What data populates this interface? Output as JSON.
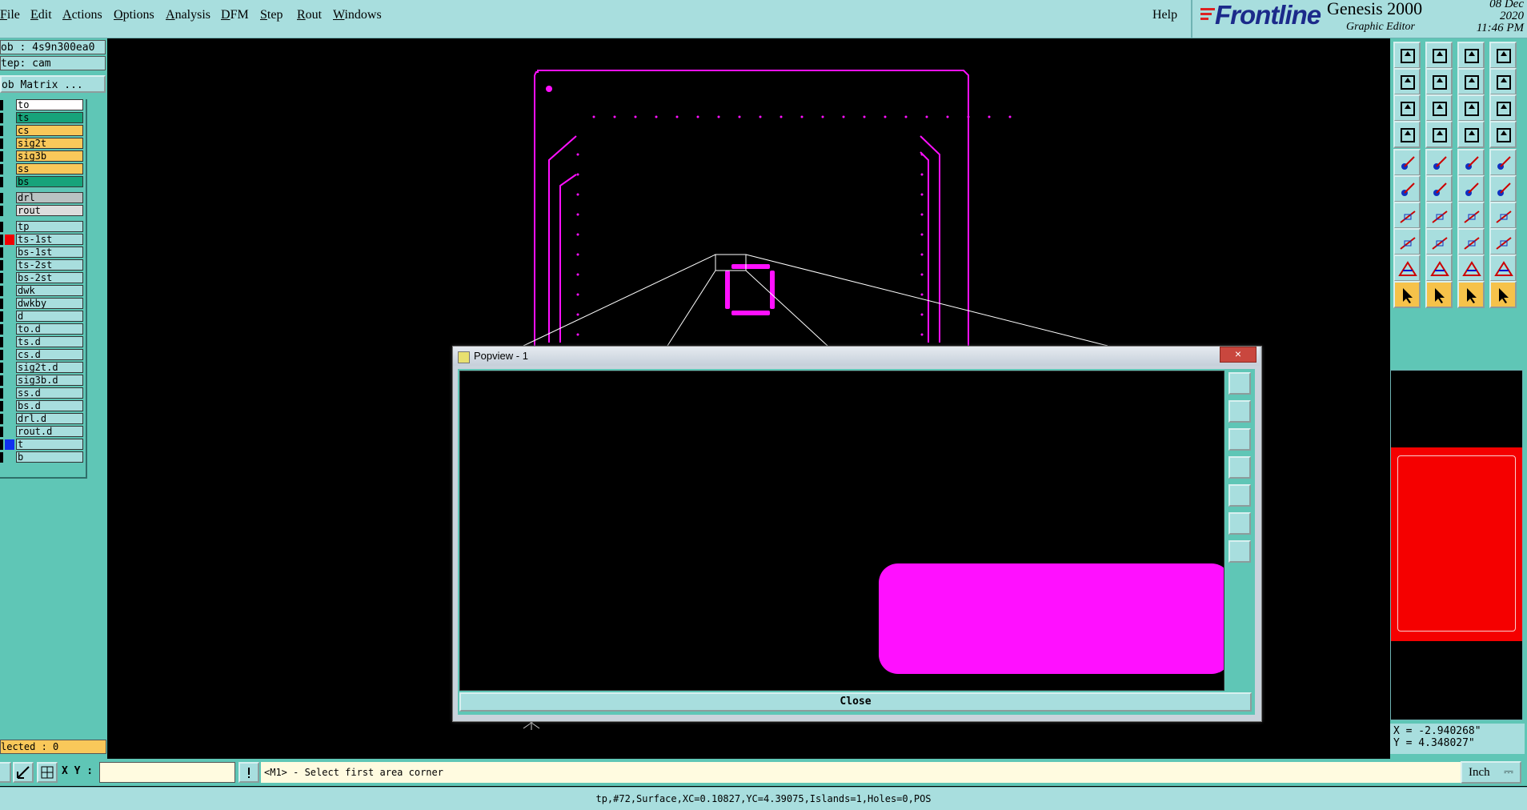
{
  "menubar": {
    "items": [
      "File",
      "Edit",
      "Actions",
      "Options",
      "Analysis",
      "DFM",
      "Step",
      "Rout",
      "Windows"
    ],
    "help": "Help"
  },
  "brand": {
    "logo": "Frontline",
    "product": "Genesis 2000",
    "subtitle": "Graphic Editor",
    "date": "08 Dec 2020",
    "time": "11:46 PM"
  },
  "left_panel": {
    "job": "ob : 4s9n300ea0",
    "step": "tep: cam",
    "matrix_button": "ob Matrix ...",
    "layers": [
      {
        "name": "to",
        "bg": "#ffffff",
        "flag": ""
      },
      {
        "name": "ts",
        "bg": "#17a37a",
        "flag": ""
      },
      {
        "name": "cs",
        "bg": "#f9c85a",
        "flag": ""
      },
      {
        "name": "sig2t",
        "bg": "#f9c85a",
        "flag": ""
      },
      {
        "name": "sig3b",
        "bg": "#f9c85a",
        "flag": ""
      },
      {
        "name": "ss",
        "bg": "#f9c85a",
        "flag": ""
      },
      {
        "name": "bs",
        "bg": "#17a37a",
        "flag": ""
      },
      {
        "name": "drl",
        "bg": "#b9c2c2",
        "flag": ""
      },
      {
        "name": "rout",
        "bg": "#dddddd",
        "flag": ""
      },
      {
        "name": "tp",
        "bg": "#a8dede",
        "flag": ""
      },
      {
        "name": "ts-1st",
        "bg": "#a8dede",
        "flag": "#f00000"
      },
      {
        "name": "bs-1st",
        "bg": "#a8dede",
        "flag": ""
      },
      {
        "name": "ts-2st",
        "bg": "#a8dede",
        "flag": ""
      },
      {
        "name": "bs-2st",
        "bg": "#a8dede",
        "flag": ""
      },
      {
        "name": "dwk",
        "bg": "#a8dede",
        "flag": ""
      },
      {
        "name": "dwkby",
        "bg": "#a8dede",
        "flag": ""
      },
      {
        "name": "d",
        "bg": "#a8dede",
        "flag": ""
      },
      {
        "name": "to.d",
        "bg": "#a8dede",
        "flag": ""
      },
      {
        "name": "ts.d",
        "bg": "#a8dede",
        "flag": ""
      },
      {
        "name": "cs.d",
        "bg": "#a8dede",
        "flag": ""
      },
      {
        "name": "sig2t.d",
        "bg": "#a8dede",
        "flag": ""
      },
      {
        "name": "sig3b.d",
        "bg": "#a8dede",
        "flag": ""
      },
      {
        "name": "ss.d",
        "bg": "#a8dede",
        "flag": ""
      },
      {
        "name": "bs.d",
        "bg": "#a8dede",
        "flag": ""
      },
      {
        "name": "drl.d",
        "bg": "#a8dede",
        "flag": ""
      },
      {
        "name": "rout.d",
        "bg": "#a8dede",
        "flag": ""
      },
      {
        "name": "t",
        "bg": "#a8dede",
        "flag": "#1030f0"
      },
      {
        "name": "b",
        "bg": "#a8dede",
        "flag": ""
      }
    ],
    "selected": "lected : 0"
  },
  "popview": {
    "title": "Popview - 1",
    "close_label": "Close",
    "close_x": "×"
  },
  "right_panel": {
    "coord_x": "X = -2.940268\"",
    "coord_y": "Y = 4.348027\""
  },
  "command_bar": {
    "xy_label": "X Y :",
    "xy_value": "",
    "prompt": "<M1> - Select first area corner",
    "units": "Inch"
  },
  "status_bar": {
    "text": "tp,#72,Surface,XC=0.10827,YC=4.39075,Islands=1,Holes=0,POS"
  },
  "colors": {
    "panel": "#5fc6b6",
    "light_panel": "#a8dede",
    "feature": "#ff10ff",
    "minimap_fill": "#f50000"
  }
}
